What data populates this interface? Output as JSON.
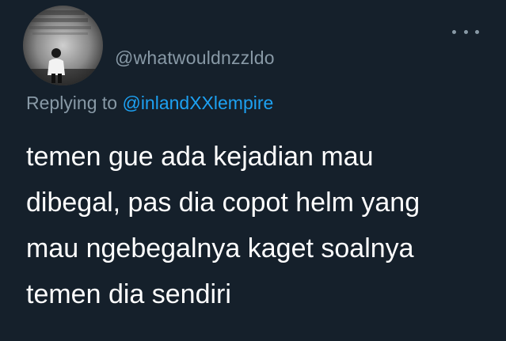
{
  "tweet": {
    "username": "@whatwouldnzzldo",
    "reply_prefix": "Replying to",
    "reply_handle": "@inlandXXlempire",
    "lines": [
      "temen gue ada kejadian mau",
      "dibegal, pas dia copot helm yang",
      "mau ngebegalnya kaget soalnya",
      "temen dia sendiri"
    ]
  },
  "icons": {
    "more": "more-horizontal-icon"
  },
  "colors": {
    "background": "#15202b",
    "secondary_text": "#8899a6",
    "link": "#1da1f2",
    "primary_text": "#ffffff"
  }
}
